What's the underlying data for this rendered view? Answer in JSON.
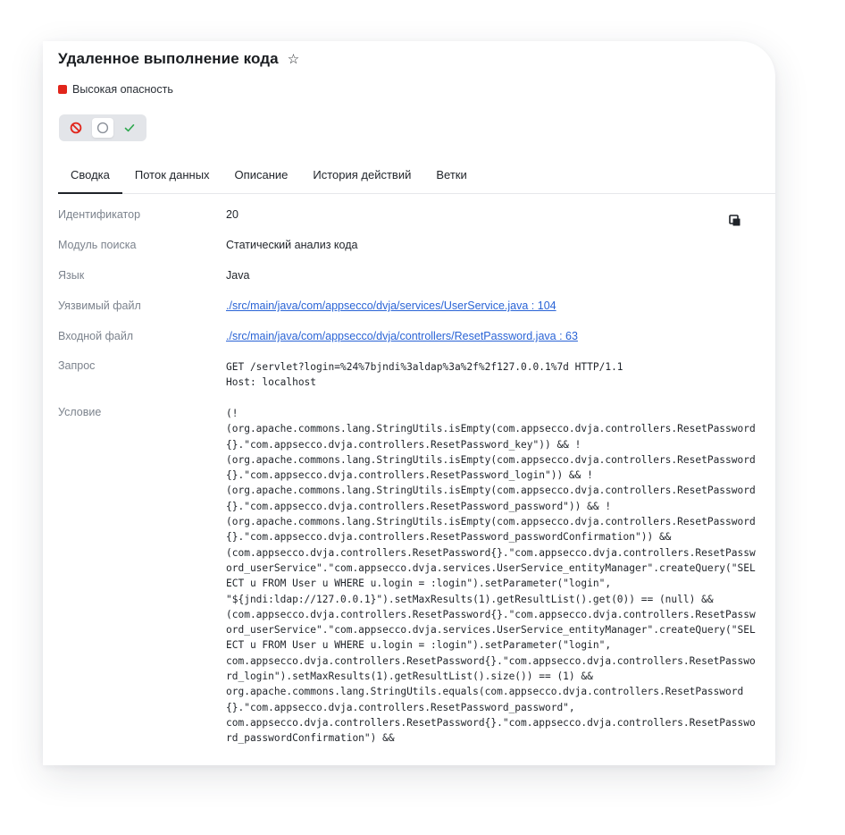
{
  "header": {
    "title": "Удаленное выполнение кода",
    "star_icon": "star-outline-icon",
    "severity": {
      "label": "Высокая опасность",
      "color": "#e1251b"
    }
  },
  "status_toggle": {
    "options": [
      {
        "icon": "prohibited-icon",
        "color": "#e1251b"
      },
      {
        "icon": "circle-icon",
        "color": "#8a9099"
      },
      {
        "icon": "check-icon",
        "color": "#2fa84f"
      }
    ],
    "selected_index": 1
  },
  "tabs": [
    {
      "label": "Сводка",
      "active": true
    },
    {
      "label": "Поток данных",
      "active": false
    },
    {
      "label": "Описание",
      "active": false
    },
    {
      "label": "История действий",
      "active": false
    },
    {
      "label": "Ветки",
      "active": false
    }
  ],
  "details": {
    "id": {
      "label": "Идентификатор",
      "value": "20"
    },
    "module": {
      "label": "Модуль поиска",
      "value": "Статический анализ кода"
    },
    "language": {
      "label": "Язык",
      "value": "Java"
    },
    "vulnerable_file": {
      "label": "Уязвимый файл",
      "value": "./src/main/java/com/appsecco/dvja/services/UserService.java : 104"
    },
    "entry_file": {
      "label": "Входной файл",
      "value": "./src/main/java/com/appsecco/dvja/controllers/ResetPassword.java : 63"
    },
    "request": {
      "label": "Запрос",
      "value": "GET /servlet?login=%24%7bjndi%3aldap%3a%2f%2f127.0.0.1%7d HTTP/1.1\nHost: localhost"
    },
    "condition": {
      "label": "Условие",
      "value": "(!\n(org.apache.commons.lang.StringUtils.isEmpty(com.appsecco.dvja.controllers.ResetPassword{}.\"com.appsecco.dvja.controllers.ResetPassword_key\")) && !\n(org.apache.commons.lang.StringUtils.isEmpty(com.appsecco.dvja.controllers.ResetPassword{}.\"com.appsecco.dvja.controllers.ResetPassword_login\")) && !\n(org.apache.commons.lang.StringUtils.isEmpty(com.appsecco.dvja.controllers.ResetPassword{}.\"com.appsecco.dvja.controllers.ResetPassword_password\")) && !\n(org.apache.commons.lang.StringUtils.isEmpty(com.appsecco.dvja.controllers.ResetPassword{}.\"com.appsecco.dvja.controllers.ResetPassword_passwordConfirmation\")) &&\n(com.appsecco.dvja.controllers.ResetPassword{}.\"com.appsecco.dvja.controllers.ResetPassword_userService\".\"com.appsecco.dvja.services.UserService_entityManager\".createQuery(\"SELECT u FROM User u WHERE u.login = :login\").setParameter(\"login\",\n\"${jndi:ldap://127.0.0.1}\").setMaxResults(1).getResultList().get(0)) == (null) &&\n(com.appsecco.dvja.controllers.ResetPassword{}.\"com.appsecco.dvja.controllers.ResetPassword_userService\".\"com.appsecco.dvja.services.UserService_entityManager\".createQuery(\"SELECT u FROM User u WHERE u.login = :login\").setParameter(\"login\",\ncom.appsecco.dvja.controllers.ResetPassword{}.\"com.appsecco.dvja.controllers.ResetPassword_login\").setMaxResults(1).getResultList().size()) == (1) &&\norg.apache.commons.lang.StringUtils.equals(com.appsecco.dvja.controllers.ResetPassword{}.\"com.appsecco.dvja.controllers.ResetPassword_password\",\ncom.appsecco.dvja.controllers.ResetPassword{}.\"com.appsecco.dvja.controllers.ResetPassword_passwordConfirmation\") &&"
    },
    "copy_icon": "copy-icon"
  }
}
